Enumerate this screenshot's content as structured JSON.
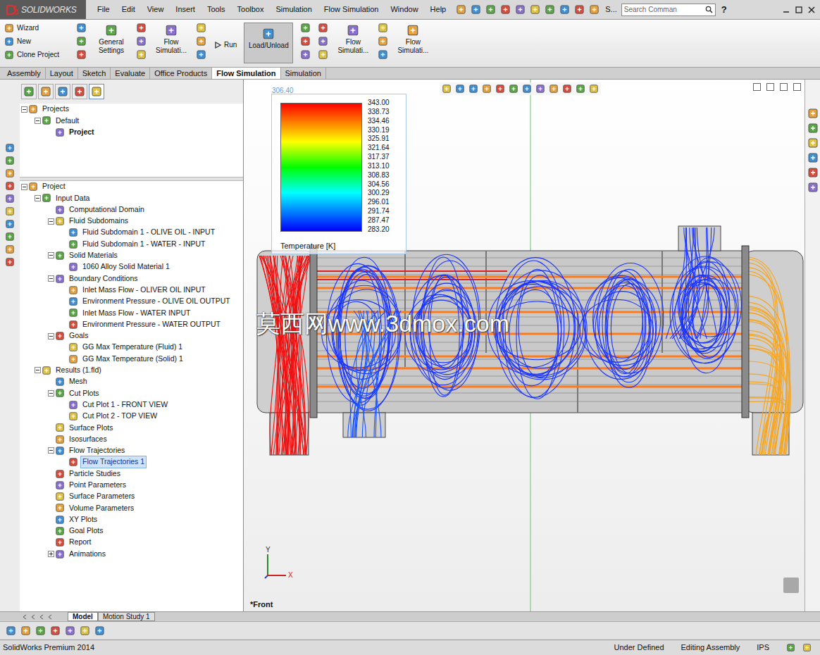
{
  "window": {
    "logo": "SOLIDWORKS"
  },
  "menu": [
    "File",
    "Edit",
    "View",
    "Insert",
    "Tools",
    "Toolbox",
    "Simulation",
    "Flow Simulation",
    "Window",
    "Help"
  ],
  "menubar_extra": "S...",
  "search": {
    "placeholder": "Search Comman"
  },
  "help": "?",
  "command_manager": [
    {
      "kind": "stack",
      "items": [
        "Wizard",
        "New",
        "Clone Project"
      ],
      "label": "",
      "pressed": false
    },
    {
      "kind": "icon-column",
      "items": [],
      "label": "",
      "pressed": false
    },
    {
      "kind": "large",
      "items": [],
      "label": "General Settings",
      "pressed": false
    },
    {
      "kind": "icon-column",
      "items": [],
      "label": "",
      "pressed": false
    },
    {
      "kind": "large",
      "items": [],
      "label": "Flow Simulati...",
      "pressed": false
    },
    {
      "kind": "icon-column",
      "items": [],
      "label": "",
      "pressed": false
    },
    {
      "kind": "small",
      "items": [],
      "label": "Run",
      "pressed": false
    },
    {
      "kind": "large",
      "items": [],
      "label": "Load/Unload",
      "pressed": true
    },
    {
      "kind": "icon-column",
      "items": [],
      "label": "",
      "pressed": false
    },
    {
      "kind": "icon-column",
      "items": [],
      "label": "",
      "pressed": false
    },
    {
      "kind": "large",
      "items": [],
      "label": "Flow Simulati...",
      "pressed": false
    },
    {
      "kind": "icon-column",
      "items": [],
      "label": "",
      "pressed": false
    },
    {
      "kind": "large",
      "items": [],
      "label": "Flow Simulati...",
      "pressed": false
    }
  ],
  "tabs": [
    {
      "label": "Assembly",
      "selected": false
    },
    {
      "label": "Layout",
      "selected": false
    },
    {
      "label": "Sketch",
      "selected": false
    },
    {
      "label": "Evaluate",
      "selected": false
    },
    {
      "label": "Office Products",
      "selected": false
    },
    {
      "label": "Flow Simulation",
      "selected": true
    },
    {
      "label": "Simulation",
      "selected": false
    }
  ],
  "projects_tree": [
    {
      "label": "Projects",
      "depth": 0,
      "toggle": "open",
      "selected": false,
      "active": false
    },
    {
      "label": "Default",
      "depth": 1,
      "toggle": "open",
      "selected": false,
      "active": false
    },
    {
      "label": "Project",
      "depth": 2,
      "toggle": "none",
      "selected": false,
      "active": true
    }
  ],
  "analysis_tree": [
    {
      "label": "Project",
      "depth": 0,
      "toggle": "open",
      "selected": false,
      "active": false
    },
    {
      "label": "Input Data",
      "depth": 1,
      "toggle": "open",
      "selected": false,
      "active": false
    },
    {
      "label": "Computational Domain",
      "depth": 2,
      "toggle": "none",
      "selected": false,
      "active": false
    },
    {
      "label": "Fluid Subdomains",
      "depth": 2,
      "toggle": "open",
      "selected": false,
      "active": false
    },
    {
      "label": "Fluid Subdomain 1 - OLIVE OIL - INPUT",
      "depth": 3,
      "toggle": "none",
      "selected": false,
      "active": false
    },
    {
      "label": "Fluid Subdomain 1 - WATER - INPUT",
      "depth": 3,
      "toggle": "none",
      "selected": false,
      "active": false
    },
    {
      "label": "Solid Materials",
      "depth": 2,
      "toggle": "open",
      "selected": false,
      "active": false
    },
    {
      "label": "1060 Alloy Solid Material 1",
      "depth": 3,
      "toggle": "none",
      "selected": false,
      "active": false
    },
    {
      "label": "Boundary Conditions",
      "depth": 2,
      "toggle": "open",
      "selected": false,
      "active": false
    },
    {
      "label": "Inlet Mass Flow - OLIVER OIL INPUT",
      "depth": 3,
      "toggle": "none",
      "selected": false,
      "active": false
    },
    {
      "label": "Environment Pressure - OLIVE OIL OUTPUT",
      "depth": 3,
      "toggle": "none",
      "selected": false,
      "active": false
    },
    {
      "label": "Inlet Mass Flow - WATER INPUT",
      "depth": 3,
      "toggle": "none",
      "selected": false,
      "active": false
    },
    {
      "label": "Environment Pressure - WATER OUTPUT",
      "depth": 3,
      "toggle": "none",
      "selected": false,
      "active": false
    },
    {
      "label": "Goals",
      "depth": 2,
      "toggle": "open",
      "selected": false,
      "active": false
    },
    {
      "label": "GG Max Temperature (Fluid) 1",
      "depth": 3,
      "toggle": "none",
      "selected": false,
      "active": false
    },
    {
      "label": "GG Max Temperature (Solid) 1",
      "depth": 3,
      "toggle": "none",
      "selected": false,
      "active": false
    },
    {
      "label": "Results (1.fld)",
      "depth": 1,
      "toggle": "open",
      "selected": false,
      "active": false
    },
    {
      "label": "Mesh",
      "depth": 2,
      "toggle": "none",
      "selected": false,
      "active": false
    },
    {
      "label": "Cut Plots",
      "depth": 2,
      "toggle": "open",
      "selected": false,
      "active": false
    },
    {
      "label": "Cut Plot 1 - FRONT VIEW",
      "depth": 3,
      "toggle": "none",
      "selected": false,
      "active": false
    },
    {
      "label": "Cut Plot 2 - TOP VIEW",
      "depth": 3,
      "toggle": "none",
      "selected": false,
      "active": false
    },
    {
      "label": "Surface Plots",
      "depth": 2,
      "toggle": "none",
      "selected": false,
      "active": false
    },
    {
      "label": "Isosurfaces",
      "depth": 2,
      "toggle": "none",
      "selected": false,
      "active": false
    },
    {
      "label": "Flow Trajectories",
      "depth": 2,
      "toggle": "open",
      "selected": false,
      "active": false
    },
    {
      "label": "Flow Trajectories 1",
      "depth": 3,
      "toggle": "none",
      "selected": true,
      "active": false
    },
    {
      "label": "Particle Studies",
      "depth": 2,
      "toggle": "none",
      "selected": false,
      "active": false
    },
    {
      "label": "Point Parameters",
      "depth": 2,
      "toggle": "none",
      "selected": false,
      "active": false
    },
    {
      "label": "Surface Parameters",
      "depth": 2,
      "toggle": "none",
      "selected": false,
      "active": false
    },
    {
      "label": "Volume Parameters",
      "depth": 2,
      "toggle": "none",
      "selected": false,
      "active": false
    },
    {
      "label": "XY Plots",
      "depth": 2,
      "toggle": "none",
      "selected": false,
      "active": false
    },
    {
      "label": "Goal Plots",
      "depth": 2,
      "toggle": "none",
      "selected": false,
      "active": false
    },
    {
      "label": "Report",
      "depth": 2,
      "toggle": "none",
      "selected": false,
      "active": false
    },
    {
      "label": "Animations",
      "depth": 2,
      "toggle": "closed",
      "selected": false,
      "active": false
    }
  ],
  "legend": {
    "top_label": "306.40",
    "values": [
      "343.00",
      "338.73",
      "334.46",
      "330.19",
      "325.91",
      "321.64",
      "317.37",
      "313.10",
      "308.83",
      "304.56",
      "300.29",
      "296.01",
      "291.74",
      "287.47",
      "283.20"
    ],
    "title": "Temperature [K]"
  },
  "viewport": {
    "view_name": "*Front",
    "axes": [
      "Y",
      "X"
    ],
    "watermark": "莫西网www.3dmox.com"
  },
  "bottom_tabs": [
    {
      "label": "Model",
      "selected": true
    },
    {
      "label": "Motion Study 1",
      "selected": false
    }
  ],
  "status_bar": {
    "product": "SolidWorks Premium 2014",
    "items": [
      "Under Defined",
      "Editing Assembly",
      "IPS"
    ]
  }
}
